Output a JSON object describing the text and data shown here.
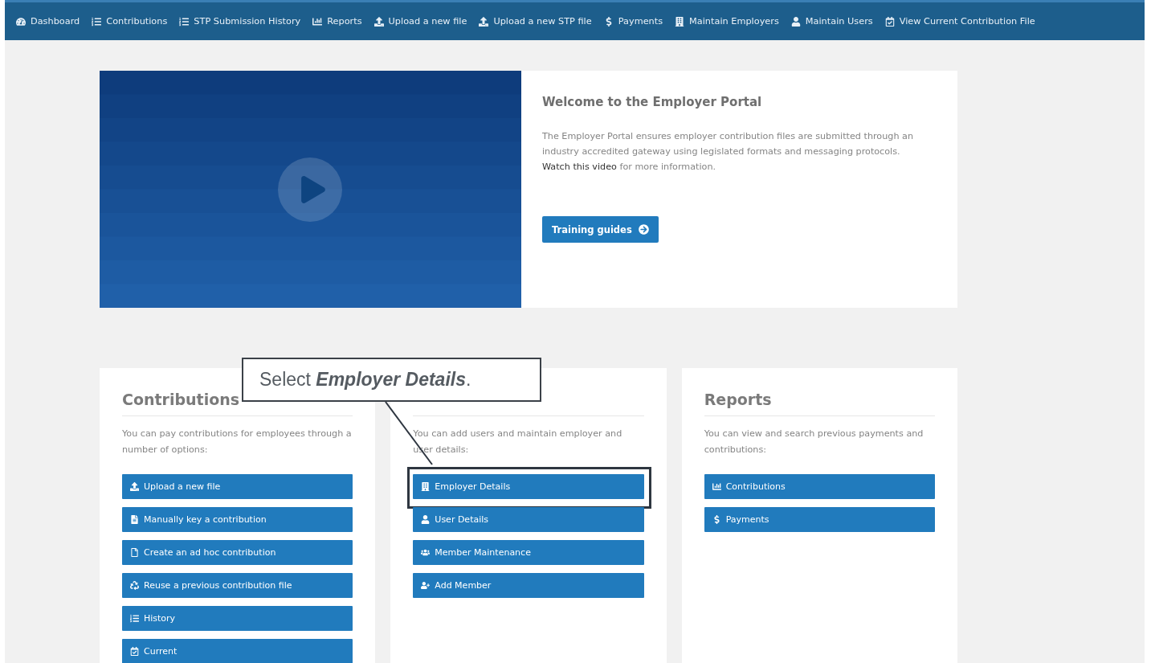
{
  "nav": [
    {
      "label": "Dashboard",
      "kind": "gauge"
    },
    {
      "label": "Contributions",
      "kind": "list"
    },
    {
      "label": "STP Submission History",
      "kind": "list"
    },
    {
      "label": "Reports",
      "kind": "chart"
    },
    {
      "label": "Upload a new file",
      "kind": "upload"
    },
    {
      "label": "Upload a new STP file",
      "kind": "upload"
    },
    {
      "label": "Payments",
      "kind": "dollar"
    },
    {
      "label": "Maintain Employers",
      "kind": "building"
    },
    {
      "label": "Maintain Users",
      "kind": "user"
    },
    {
      "label": "View Current Contribution File",
      "kind": "calendar"
    }
  ],
  "welcome": {
    "title": "Welcome to the Employer Portal",
    "body": "The Employer Portal ensures employer contribution files are submitted through an industry accredited gateway using legislated formats and messaging protocols.",
    "link": "Watch this video",
    "after_link": "for more information.",
    "button": "Training guides"
  },
  "cards": [
    {
      "title": "Contributions",
      "text": "You can pay contributions for employees through a number of options:",
      "buttons": [
        {
          "label": "Upload a new file",
          "kind": "upload",
          "highlighted": false
        },
        {
          "label": "Manually key a contribution",
          "kind": "file-text",
          "highlighted": false
        },
        {
          "label": "Create an ad hoc contribution",
          "kind": "file",
          "highlighted": false
        },
        {
          "label": "Reuse a previous contribution file",
          "kind": "recycle",
          "highlighted": false
        },
        {
          "label": "History",
          "kind": "list",
          "highlighted": false
        },
        {
          "label": "Current",
          "kind": "calendar",
          "highlighted": false
        }
      ]
    },
    {
      "text": "You can add users and maintain employer and user details:",
      "buttons": [
        {
          "label": "Employer Details",
          "kind": "building",
          "highlighted": true
        },
        {
          "label": "User Details",
          "kind": "user",
          "highlighted": false
        },
        {
          "label": "Member Maintenance",
          "kind": "users",
          "highlighted": false
        },
        {
          "label": "Add Member",
          "kind": "user-plus",
          "highlighted": false
        }
      ]
    },
    {
      "title": "Reports",
      "text": "You can view and search previous payments and contributions:",
      "buttons": [
        {
          "label": "Contributions",
          "kind": "chart",
          "highlighted": false
        },
        {
          "label": "Payments",
          "kind": "dollar",
          "highlighted": false
        }
      ]
    }
  ],
  "callout": {
    "text": "Select **Employer Details**."
  }
}
